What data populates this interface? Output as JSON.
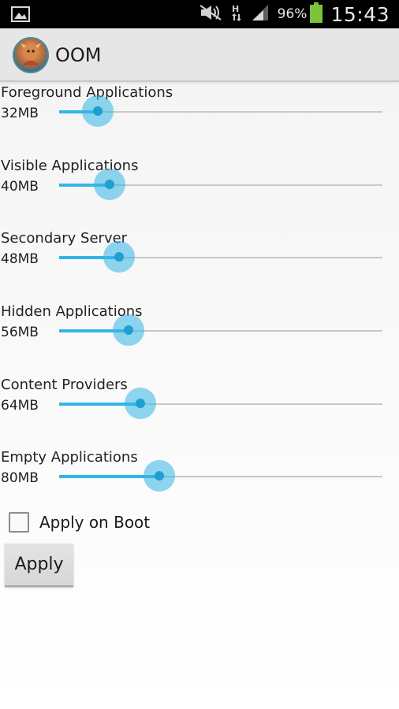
{
  "status_bar": {
    "battery_percent": "96%",
    "clock": "15:43",
    "accent": "#000000",
    "battery_color": "#7ec13a",
    "icons": [
      "gallery-icon",
      "mute-icon",
      "hsdpa-icon",
      "signal-icon",
      "battery-icon"
    ]
  },
  "app": {
    "title": "OOM"
  },
  "colors": {
    "slider_accent": "#33b5e5",
    "slider_track": "#c8c8c8"
  },
  "settings": [
    {
      "label": "Foreground Applications",
      "value": "32MB",
      "level": 0.12
    },
    {
      "label": "Visible Applications",
      "value": "40MB",
      "level": 0.155
    },
    {
      "label": "Secondary Server",
      "value": "48MB",
      "level": 0.185
    },
    {
      "label": "Hidden Applications",
      "value": "56MB",
      "level": 0.215
    },
    {
      "label": "Content Providers",
      "value": "64MB",
      "level": 0.25
    },
    {
      "label": "Empty Applications",
      "value": "80MB",
      "level": 0.31
    }
  ],
  "apply_on_boot": {
    "label": "Apply on Boot",
    "checked": false
  },
  "apply_button": {
    "label": "Apply"
  }
}
